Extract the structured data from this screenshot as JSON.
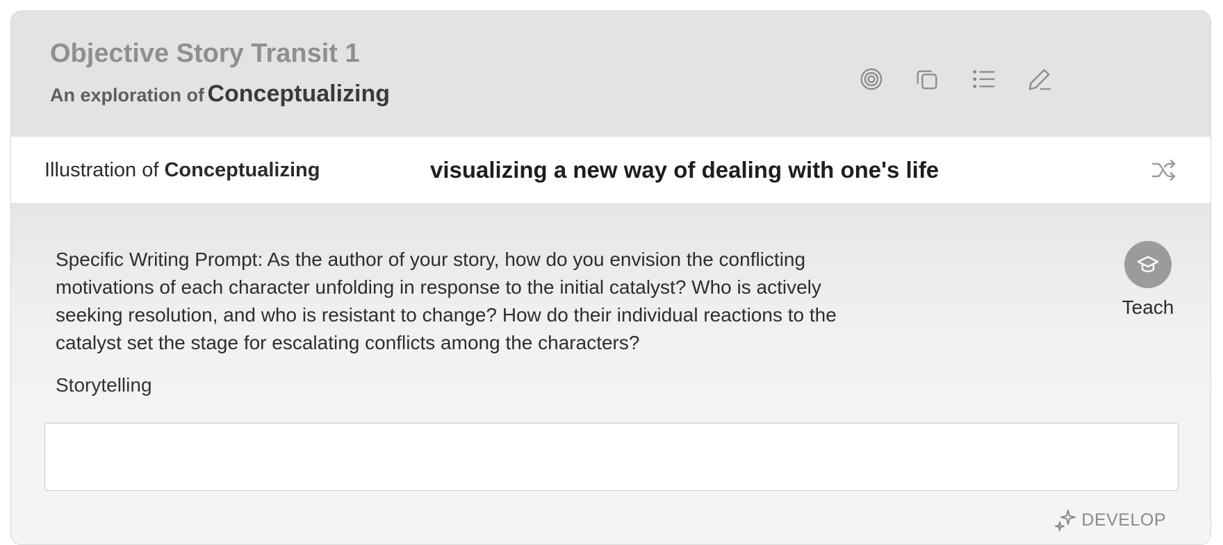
{
  "header": {
    "title": "Objective Story Transit 1",
    "subtitle_prefix": "An exploration of",
    "subtitle_topic": "Conceptualizing",
    "icons": [
      "target-icon",
      "copy-icon",
      "list-icon",
      "edit-icon"
    ]
  },
  "illustration": {
    "label_prefix": "Illustration of",
    "label_topic": "Conceptualizing",
    "text": "visualizing a new way of dealing with one's life",
    "shuffle_icon": "shuffle-icon"
  },
  "prompt": {
    "text": "Specific Writing Prompt: As the author of your story, how do you envision the conflicting motivations of each character unfolding in response to the initial catalyst? Who is actively seeking resolution, and who is resistant to change? How do their individual reactions to the catalyst set the stage for escalating conflicts among the characters?"
  },
  "teach": {
    "label": "Teach",
    "icon": "graduation-cap-icon"
  },
  "storytelling": {
    "label": "Storytelling",
    "value": "",
    "placeholder": ""
  },
  "develop": {
    "label": "DEVELOP",
    "icon": "sparkle-icon"
  },
  "colors": {
    "header_bg": "#e3e3e3",
    "title": "#8f8f8f",
    "teach_circle": "#9b9b9b",
    "icon": "#8a8a8a"
  }
}
